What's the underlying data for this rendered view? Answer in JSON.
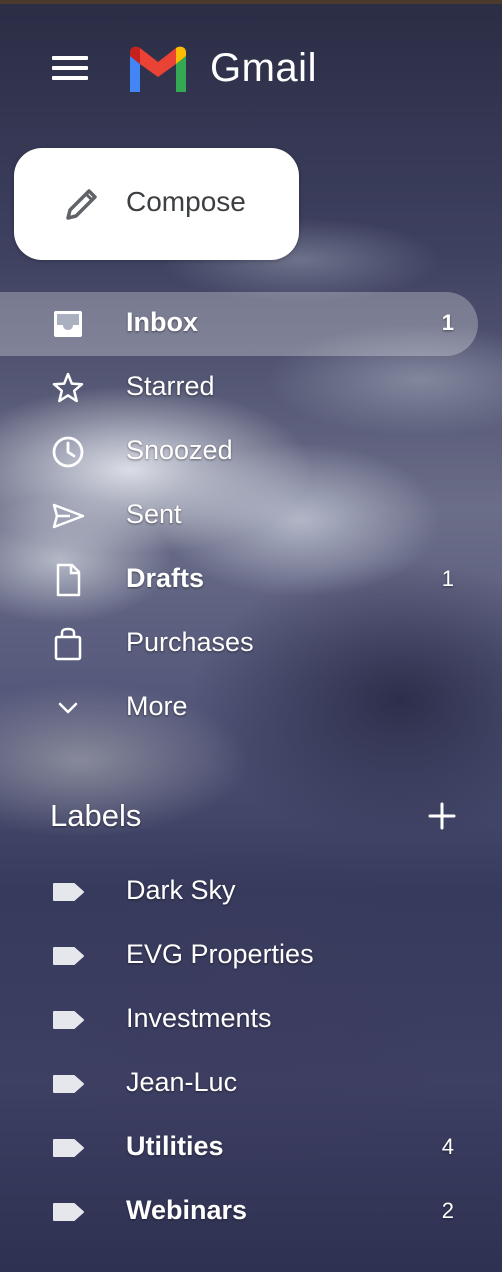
{
  "app": {
    "name": "Gmail"
  },
  "compose": {
    "label": "Compose"
  },
  "nav": [
    {
      "label": "Inbox",
      "count": "1",
      "bold": true,
      "active": true,
      "icon": "inbox-icon"
    },
    {
      "label": "Starred",
      "count": "",
      "bold": false,
      "active": false,
      "icon": "star-icon"
    },
    {
      "label": "Snoozed",
      "count": "",
      "bold": false,
      "active": false,
      "icon": "clock-icon"
    },
    {
      "label": "Sent",
      "count": "",
      "bold": false,
      "active": false,
      "icon": "send-icon"
    },
    {
      "label": "Drafts",
      "count": "1",
      "bold": true,
      "active": false,
      "icon": "file-icon"
    },
    {
      "label": "Purchases",
      "count": "",
      "bold": false,
      "active": false,
      "icon": "shopping-bag-icon"
    },
    {
      "label": "More",
      "count": "",
      "bold": false,
      "active": false,
      "icon": "chevron-down-icon"
    }
  ],
  "labels_section": {
    "title": "Labels",
    "items": [
      {
        "label": "Dark Sky",
        "count": "",
        "bold": false
      },
      {
        "label": "EVG Properties",
        "count": "",
        "bold": false
      },
      {
        "label": "Investments",
        "count": "",
        "bold": false
      },
      {
        "label": "Jean-Luc",
        "count": "",
        "bold": false
      },
      {
        "label": "Utilities",
        "count": "4",
        "bold": true
      },
      {
        "label": "Webinars",
        "count": "2",
        "bold": true
      }
    ]
  },
  "colors": {
    "logo_blue": "#4285F4",
    "logo_red": "#EA4335",
    "logo_yellow": "#FBBC04",
    "logo_green": "#34A853",
    "compose_bg": "#FFFFFF",
    "compose_text": "#3C4043"
  }
}
